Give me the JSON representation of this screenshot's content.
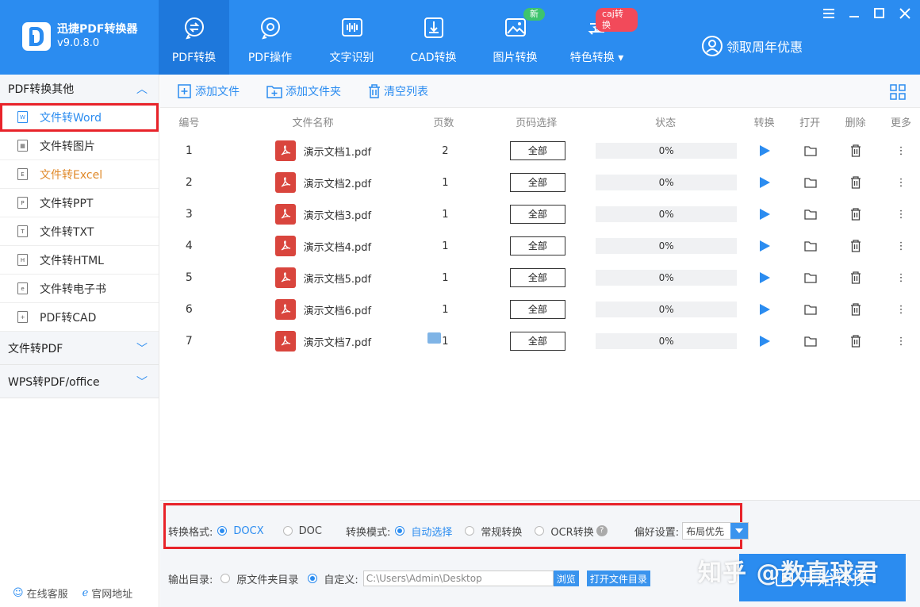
{
  "app": {
    "title": "迅捷PDF转换器",
    "version": "v9.0.8.0"
  },
  "nav": [
    {
      "label": "PDF转换",
      "badge": ""
    },
    {
      "label": "PDF操作",
      "badge": ""
    },
    {
      "label": "文字识别",
      "badge": ""
    },
    {
      "label": "CAD转换",
      "badge": ""
    },
    {
      "label": "图片转换",
      "badge": "新"
    },
    {
      "label": "特色转换",
      "badge": "caj转换"
    }
  ],
  "promo": "领取周年优惠",
  "sidebar": {
    "section1": "PDF转换其他",
    "items": [
      "文件转Word",
      "文件转图片",
      "文件转Excel",
      "文件转PPT",
      "文件转TXT",
      "文件转HTML",
      "文件转电子书",
      "PDF转CAD"
    ],
    "section2": "文件转PDF",
    "section3": "WPS转PDF/office",
    "footer": {
      "service": "在线客服",
      "website": "官网地址"
    }
  },
  "toolbar": {
    "add_file": "添加文件",
    "add_folder": "添加文件夹",
    "clear": "清空列表"
  },
  "table": {
    "headers": {
      "num": "编号",
      "name": "文件名称",
      "pages": "页数",
      "range": "页码选择",
      "status": "状态",
      "convert": "转换",
      "open": "打开",
      "delete": "删除",
      "more": "更多"
    },
    "rows": [
      {
        "num": "1",
        "name": "演示文档1.pdf",
        "pages": "2",
        "range": "全部",
        "status": "0%"
      },
      {
        "num": "2",
        "name": "演示文档2.pdf",
        "pages": "1",
        "range": "全部",
        "status": "0%"
      },
      {
        "num": "3",
        "name": "演示文档3.pdf",
        "pages": "1",
        "range": "全部",
        "status": "0%"
      },
      {
        "num": "4",
        "name": "演示文档4.pdf",
        "pages": "1",
        "range": "全部",
        "status": "0%"
      },
      {
        "num": "5",
        "name": "演示文档5.pdf",
        "pages": "1",
        "range": "全部",
        "status": "0%"
      },
      {
        "num": "6",
        "name": "演示文档6.pdf",
        "pages": "1",
        "range": "全部",
        "status": "0%"
      },
      {
        "num": "7",
        "name": "演示文档7.pdf",
        "pages": "1",
        "range": "全部",
        "status": "0%"
      }
    ]
  },
  "options": {
    "format_label": "转换格式:",
    "format_docx": "DOCX",
    "format_doc": "DOC",
    "mode_label": "转换模式:",
    "mode_auto": "自动选择",
    "mode_normal": "常规转换",
    "mode_ocr": "OCR转换",
    "pref_label": "偏好设置:",
    "pref_value": "布局优先",
    "output_label": "输出目录:",
    "output_orig": "原文件夹目录",
    "output_custom": "自定义:",
    "output_path": "C:\\Users\\Admin\\Desktop",
    "browse": "浏览",
    "open_dir": "打开文件目录",
    "start": "开始转换"
  },
  "watermark": "知乎 @数直球君",
  "colors": {
    "primary": "#2b8cf0",
    "highlight": "#e8232a",
    "pdf_red": "#d9453d"
  }
}
